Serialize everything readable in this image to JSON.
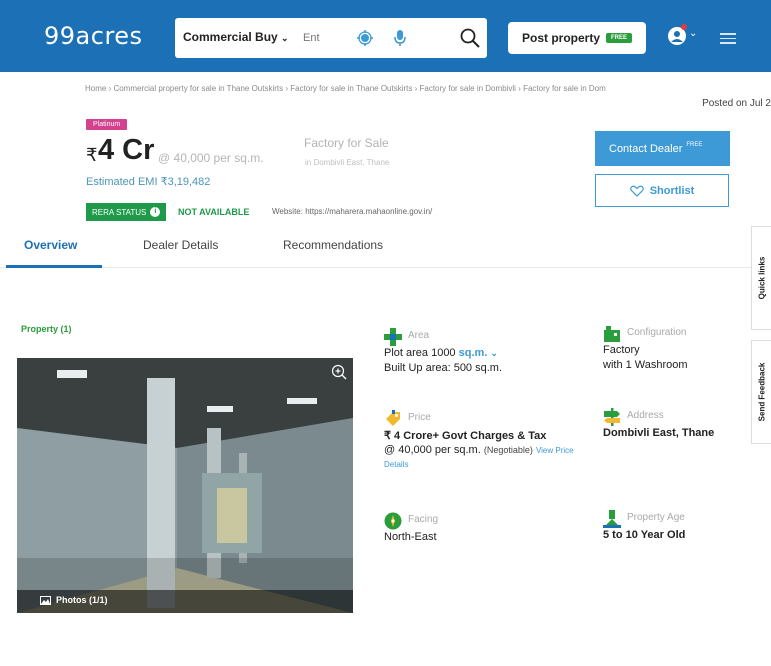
{
  "header": {
    "logo": "99acres",
    "search_select": "Commercial Buy",
    "search_placeholder": "Ent",
    "post_property_label": "Post property",
    "post_property_tag": "FREE",
    "brand_color": "#1c70b5"
  },
  "breadcrumb": "Home › Commercial property for sale in Thane Outskirts › Factory for sale in Thane Outskirts › Factory for sale in Dombivli › Factory for sale in Dom",
  "posted": "Posted on Jul 2",
  "listing": {
    "badge": "Platinum",
    "price_symbol": "₹",
    "price": "4 Cr",
    "price_per_unit": "@ 40,000 per sq.m.",
    "title": "Factory for Sale",
    "location": "in Dombivli East, Thane",
    "emi": "Estimated EMI ₹3,19,482",
    "rera_label": "RERA STATUS",
    "rera_status": "NOT AVAILABLE",
    "website": "Website: https://maharera.mahaonline.gov.in/"
  },
  "actions": {
    "contact_label": "Contact Dealer",
    "contact_tag": "FREE",
    "shortlist_label": "Shortlist"
  },
  "tabs": [
    "Overview",
    "Dealer Details",
    "Recommendations"
  ],
  "side_tabs": [
    "Quick links",
    "Send Feedback"
  ],
  "property_section": {
    "label": "Property (1)",
    "photos_label": "Photos (1/1)"
  },
  "attributes": {
    "area": {
      "label": "Area",
      "line1_prefix": "Plot area 1000",
      "line1_unit": "sq.m.",
      "line2": "Built Up area: 500 sq.m."
    },
    "configuration": {
      "label": "Configuration",
      "line1": "Factory",
      "line2": "with 1 Washroom"
    },
    "price": {
      "label": "Price",
      "line1": "₹ 4 Crore+ Govt Charges & Tax",
      "line2": "@ 40,000 per sq.m.",
      "negotiable": "(Negotiable)",
      "view_link": "View Price",
      "details_link": "Details"
    },
    "address": {
      "label": "Address",
      "line1": "Dombivli East, Thane"
    },
    "facing": {
      "label": "Facing",
      "line1": "North-East"
    },
    "age": {
      "label": "Property Age",
      "line1": "5 to 10 Year Old"
    }
  }
}
